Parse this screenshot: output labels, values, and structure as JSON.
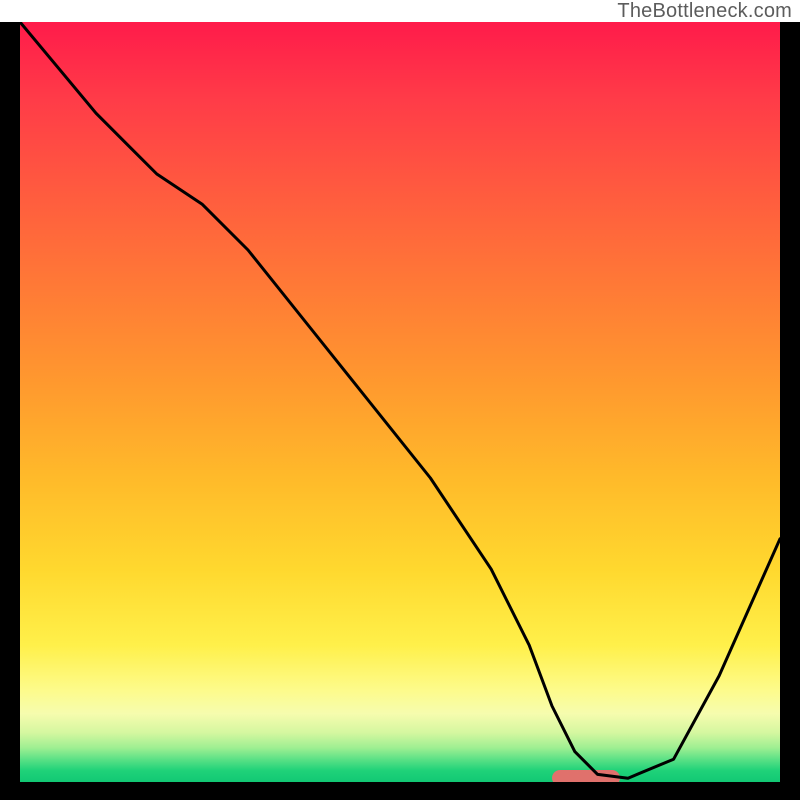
{
  "attribution": "TheBottleneck.com",
  "chart_data": {
    "type": "line",
    "title": "",
    "xlabel": "",
    "ylabel": "",
    "xlim": [
      0,
      100
    ],
    "ylim": [
      0,
      100
    ],
    "series": [
      {
        "name": "bottleneck-curve",
        "x": [
          0,
          5,
          10,
          18,
          24,
          30,
          38,
          46,
          54,
          62,
          67,
          70,
          73,
          76,
          80,
          86,
          92,
          100
        ],
        "values": [
          100,
          94,
          88,
          80,
          76,
          70,
          60,
          50,
          40,
          28,
          18,
          10,
          4,
          1,
          0.5,
          3,
          14,
          32
        ]
      }
    ],
    "optimum_marker": {
      "x_start": 70,
      "x_end": 79,
      "y": 0.5
    },
    "gradient_stops": [
      {
        "pct": 0,
        "color": "#ff1b4a"
      },
      {
        "pct": 22,
        "color": "#ff5a3f"
      },
      {
        "pct": 48,
        "color": "#ff9a2e"
      },
      {
        "pct": 72,
        "color": "#ffd82e"
      },
      {
        "pct": 88,
        "color": "#fdfb8c"
      },
      {
        "pct": 95.5,
        "color": "#9eef92"
      },
      {
        "pct": 100,
        "color": "#12c874"
      }
    ]
  }
}
